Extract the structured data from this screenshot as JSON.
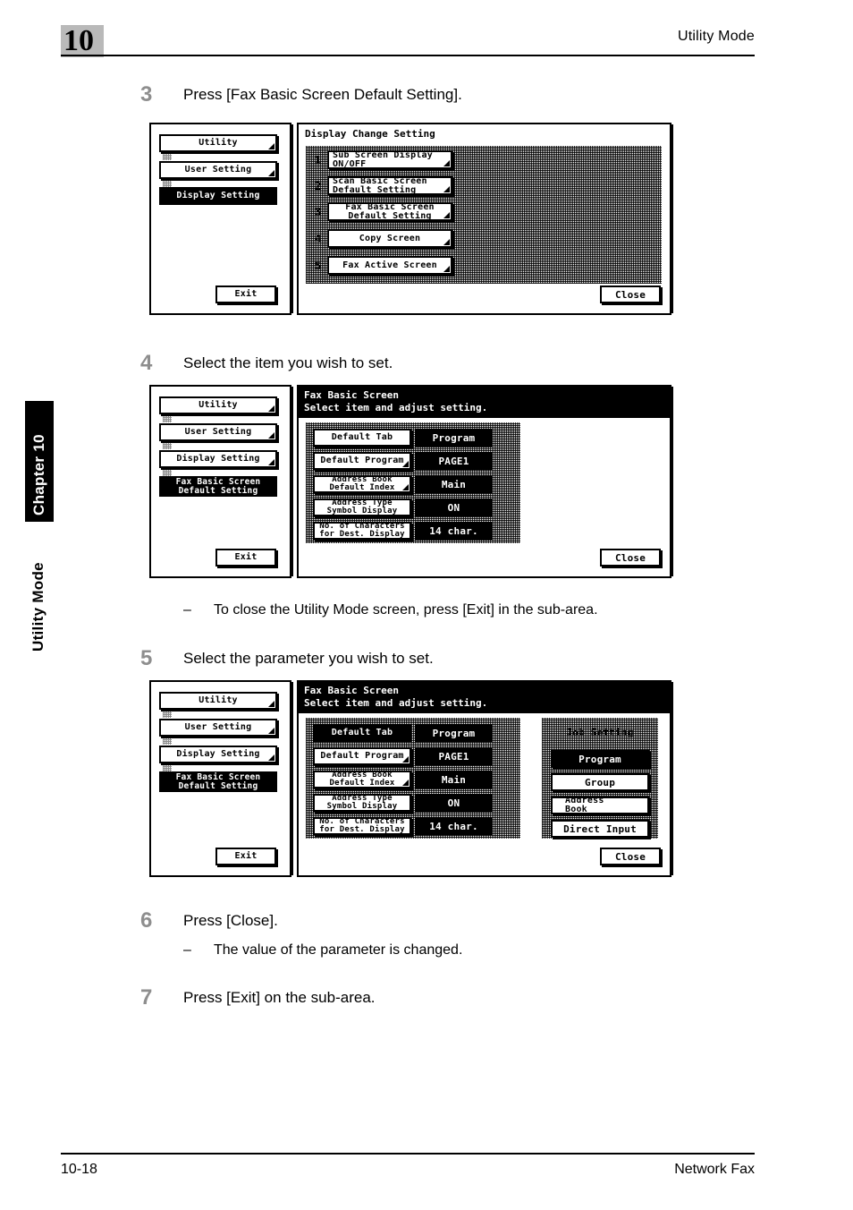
{
  "page": {
    "chapter_number": "10",
    "header_title": "Utility Mode",
    "side_tab_chapter": "Chapter 10",
    "side_tab_section": "Utility Mode",
    "footer_page": "10-18",
    "footer_title": "Network Fax"
  },
  "steps": [
    {
      "num": "3",
      "text": "Press [Fax Basic Screen Default Setting]."
    },
    {
      "num": "4",
      "text": "Select the item you wish to set."
    },
    {
      "num": "5",
      "text": "Select the parameter you wish to set."
    },
    {
      "num": "6",
      "text": "Press [Close]."
    },
    {
      "num": "7",
      "text": "Press [Exit] on the sub-area."
    }
  ],
  "notes": [
    {
      "dash": "–",
      "text": "To close the Utility Mode screen, press [Exit] in the sub-area."
    },
    {
      "dash": "–",
      "text": "The value of the parameter is changed."
    }
  ],
  "screens": {
    "display_change_setting": {
      "sub_area": {
        "buttons": [
          {
            "label": "Utility",
            "selected": false
          },
          {
            "label": "User Setting",
            "selected": false
          },
          {
            "label": "Display Setting",
            "selected": true
          }
        ],
        "exit_label": "Exit"
      },
      "title": "Display Change Setting",
      "items": [
        {
          "num": "1",
          "label": "Sub Screen Display\nON/OFF"
        },
        {
          "num": "2",
          "label": "Scan Basic Screen\nDefault Setting"
        },
        {
          "num": "3",
          "label": "Fax Basic Screen\nDefault Setting"
        },
        {
          "num": "4",
          "label": "Copy Screen"
        },
        {
          "num": "5",
          "label": "Fax Active Screen"
        }
      ],
      "close_label": "Close"
    },
    "fax_basic_screen_items": {
      "sub_area": {
        "buttons": [
          {
            "label": "Utility",
            "selected": false
          },
          {
            "label": "User Setting",
            "selected": false
          },
          {
            "label": "Display Setting",
            "selected": false
          },
          {
            "label": "Fax Basic Screen\nDefault Setting",
            "selected": true
          }
        ],
        "exit_label": "Exit"
      },
      "title": "Fax Basic Screen",
      "subtitle": "Select item and adjust setting.",
      "rows": [
        {
          "name": "Default Tab",
          "value": "Program",
          "selected": false,
          "dropdown": false
        },
        {
          "name": "Default Program",
          "value": "PAGE1",
          "selected": false,
          "dropdown": true
        },
        {
          "name": "Address Book\nDefault Index",
          "value": "Main",
          "selected": false,
          "dropdown": true
        },
        {
          "name": "Address Type\nSymbol Display",
          "value": "ON",
          "selected": false,
          "dropdown": false
        },
        {
          "name": "No. of Characters\nfor Dest. Display",
          "value": "14 char.",
          "selected": false,
          "dropdown": false
        }
      ],
      "close_label": "Close"
    },
    "fax_basic_screen_params": {
      "sub_area": {
        "buttons": [
          {
            "label": "Utility",
            "selected": false
          },
          {
            "label": "User Setting",
            "selected": false
          },
          {
            "label": "Display Setting",
            "selected": false
          },
          {
            "label": "Fax Basic Screen\nDefault Setting",
            "selected": true
          }
        ],
        "exit_label": "Exit"
      },
      "title": "Fax Basic Screen",
      "subtitle": "Select item and adjust setting.",
      "rows": [
        {
          "name": "Default Tab",
          "value": "Program",
          "selected": true,
          "dropdown": false
        },
        {
          "name": "Default Program",
          "value": "PAGE1",
          "selected": false,
          "dropdown": true
        },
        {
          "name": "Address Book\nDefault Index",
          "value": "Main",
          "selected": false,
          "dropdown": true
        },
        {
          "name": "Address Type\nSymbol Display",
          "value": "ON",
          "selected": false,
          "dropdown": false
        },
        {
          "name": "No. of Characters\nfor Dest. Display",
          "value": "14 char.",
          "selected": false,
          "dropdown": false
        }
      ],
      "param_panel": {
        "title": "Job Setting",
        "options": [
          {
            "label": "Program",
            "selected": true
          },
          {
            "label": "Group",
            "selected": false
          },
          {
            "label": "Address\nBook",
            "selected": false
          },
          {
            "label": "Direct Input",
            "selected": false
          }
        ]
      },
      "close_label": "Close"
    }
  }
}
